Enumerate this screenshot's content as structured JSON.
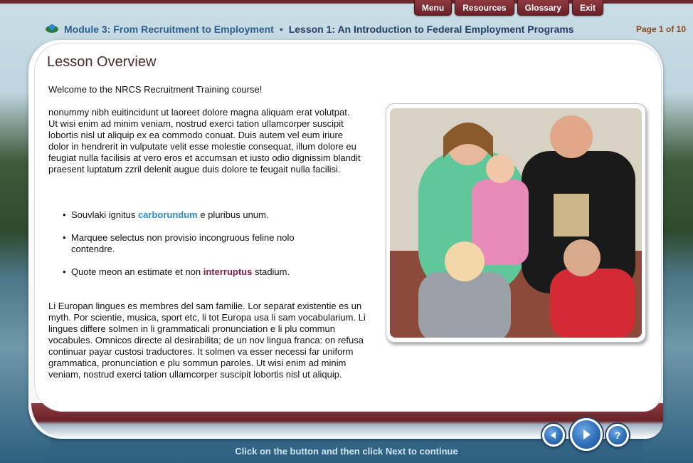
{
  "topnav": {
    "items": [
      "Menu",
      "Resources",
      "Glossary",
      "Exit"
    ]
  },
  "header": {
    "module": "Module 3: From Recruitment to Employment",
    "bullet": "•",
    "lesson": "Lesson 1: An Introduction to Federal Employment Programs",
    "page": "Page 1 of 10"
  },
  "content": {
    "title": "Lesson Overview",
    "welcome": "Welcome to the NRCS Recruitment Training course!",
    "para1": "nonummy nibh euitincidunt ut laoreet dolore magna aliquam erat volutpat. Ut wisi enim ad minim veniam, nostrud exerci tation ullamcorper suscipit lobortis nisl ut aliquip ex ea commodo conuat. Duis autem vel eum iriure dolor in hendrerit in vulputate velit esse molestie consequat, illum dolore eu feugiat nulla facilisis at vero eros et accumsan et iusto odio dignissim blandit praesent luptatum zzril delenit augue duis dolore te feugait nulla facilisi.",
    "bullets": [
      {
        "pre": "Souvlaki ignitus ",
        "highlight": "carborundum",
        "post": " e pluribus unum."
      },
      {
        "pre": "Marquee selectus non provisio incongruous feline nolo contendre.",
        "highlight": "",
        "post": ""
      },
      {
        "pre": "Quote meon an estimate et non ",
        "highlight": "interruptus",
        "post": " stadium."
      }
    ],
    "para2": "Li Europan lingues es membres del sam familie. Lor separat existentie es un myth. Por scientie, musica, sport etc, li tot Europa usa li sam vocabularium. Li lingues differe solmen in li grammaticali pronunciation e li plu commun vocabules. Omnicos directe al desirabilita; de un nov lingua franca: on refusa continuar payar custosi traductores. It solmen va esser necessi far uniform grammatica, pronunciation e plu sommun paroles. Ut wisi enim ad minim veniam, nostrud exerci tation ullamcorper suscipit lobortis nisl ut aliquip."
  },
  "footer": {
    "instruction": "Click on the button and then click Next to continue",
    "help_glyph": "?"
  },
  "colors": {
    "nav_button": "#7a2a30",
    "module_text": "#2d5f8c",
    "highlight_blue": "#2d8ac9",
    "highlight_purple": "#7a1f4a",
    "page_number": "#8a4a1a"
  }
}
